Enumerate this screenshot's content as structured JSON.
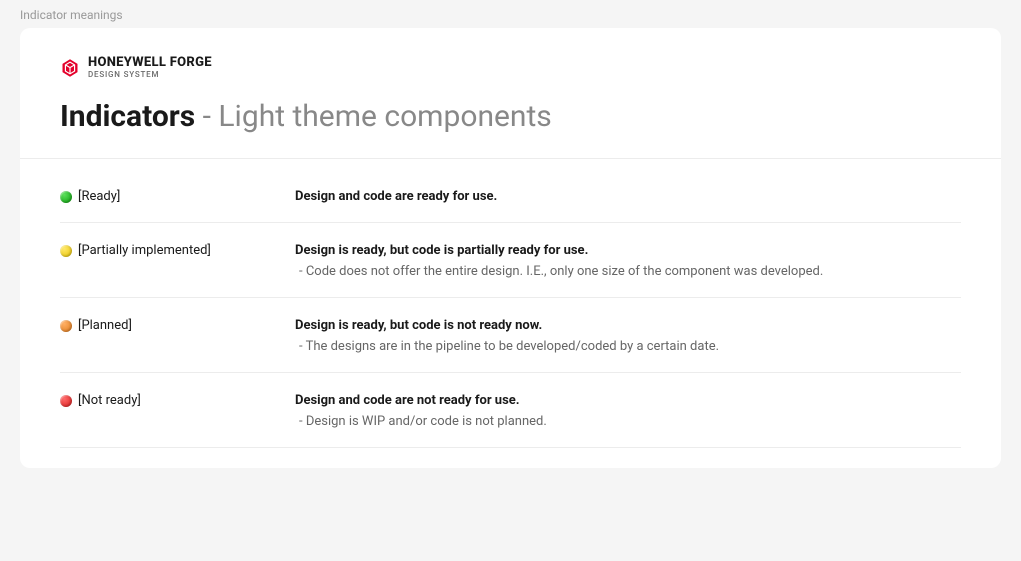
{
  "pageLabel": "Indicator meanings",
  "brand": {
    "title": "HONEYWELL FORGE",
    "subtitle": "DESIGN SYSTEM"
  },
  "title": {
    "bold": "Indicators",
    "sep": " - ",
    "light": "Light theme components"
  },
  "indicators": [
    {
      "dotClass": "dot-green",
      "label": "[Ready]",
      "primary": "Design and code are ready for use.",
      "secondary": ""
    },
    {
      "dotClass": "dot-yellow",
      "label": "[Partially implemented]",
      "primary": "Design is ready, but code is partially ready for use.",
      "secondary": " - Code does not offer the entire design. I.E., only one size of the component was developed."
    },
    {
      "dotClass": "dot-orange",
      "label": "[Planned]",
      "primary": "Design is ready, but code is not ready now.",
      "secondary": " - The designs are in the pipeline to be developed/coded by a certain date."
    },
    {
      "dotClass": "dot-red",
      "label": "[Not ready]",
      "primary": "Design and code are not ready for use.",
      "secondary": " - Design is WIP and/or code is not planned."
    }
  ]
}
